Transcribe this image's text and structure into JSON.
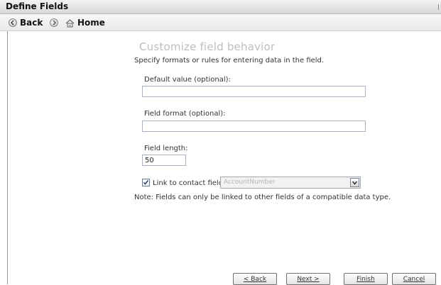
{
  "window": {
    "title": "Define Fields"
  },
  "nav": {
    "back_label": "Back",
    "home_label": "Home"
  },
  "page": {
    "heading": "Customize field behavior",
    "subtitle": "Specify formats or rules for entering data in the field."
  },
  "fields": {
    "default_value": {
      "label": "Default value (optional):",
      "value": ""
    },
    "field_format": {
      "label": "Field format (optional):",
      "value": ""
    },
    "field_length": {
      "label": "Field length:",
      "value": "50"
    }
  },
  "link": {
    "checkbox_label": "Link to contact field:",
    "checked": true,
    "selected_value": "AccountNumber",
    "note": "Note: Fields can only be linked to other fields of a compatible data type."
  },
  "buttons": {
    "back": "< Back",
    "next": "Next >",
    "finish": "Finish",
    "cancel": "Cancel"
  }
}
